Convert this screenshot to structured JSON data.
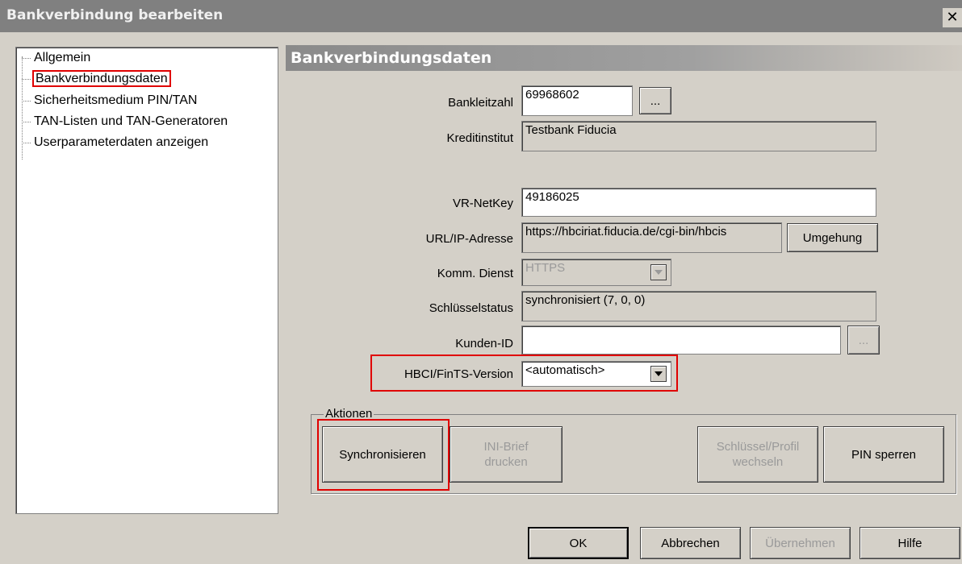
{
  "window": {
    "title": "Bankverbindung bearbeiten",
    "close_label": "✕"
  },
  "tree": {
    "items": [
      {
        "label": "Allgemein"
      },
      {
        "label": "Bankverbindungsdaten"
      },
      {
        "label": "Sicherheitsmedium PIN/TAN"
      },
      {
        "label": "TAN-Listen und TAN-Generatoren"
      },
      {
        "label": "Userparameterdaten anzeigen"
      }
    ]
  },
  "panel": {
    "title": "Bankverbindungsdaten"
  },
  "form": {
    "bankleitzahl": {
      "label": "Bankleitzahl",
      "value": "69968602",
      "browse": "..."
    },
    "kreditinstitut": {
      "label": "Kreditinstitut",
      "value": "Testbank Fiducia"
    },
    "vrnetkey": {
      "label": "VR-NetKey",
      "value": "49186025"
    },
    "url": {
      "label": "URL/IP-Adresse",
      "value": "https://hbciriat.fiducia.de/cgi-bin/hbcis",
      "button": "Umgehung"
    },
    "komm": {
      "label": "Komm. Dienst",
      "value": "HTTPS"
    },
    "schluessel": {
      "label": "Schlüsselstatus",
      "value": "synchronisiert (7, 0, 0)"
    },
    "kunden": {
      "label": "Kunden-ID",
      "value": "",
      "browse": "..."
    },
    "hbci": {
      "label": "HBCI/FinTS-Version",
      "value": "<automatisch>"
    }
  },
  "actions": {
    "legend": "Aktionen",
    "sync": "Synchronisieren",
    "ini_line1": "INI-Brief",
    "ini_line2": "drucken",
    "schluessel_line1": "Schlüssel/Profil",
    "schluessel_line2": "wechseln",
    "pin": "PIN sperren"
  },
  "footer": {
    "ok": "OK",
    "cancel": "Abbrechen",
    "apply": "Übernehmen",
    "help": "Hilfe"
  }
}
